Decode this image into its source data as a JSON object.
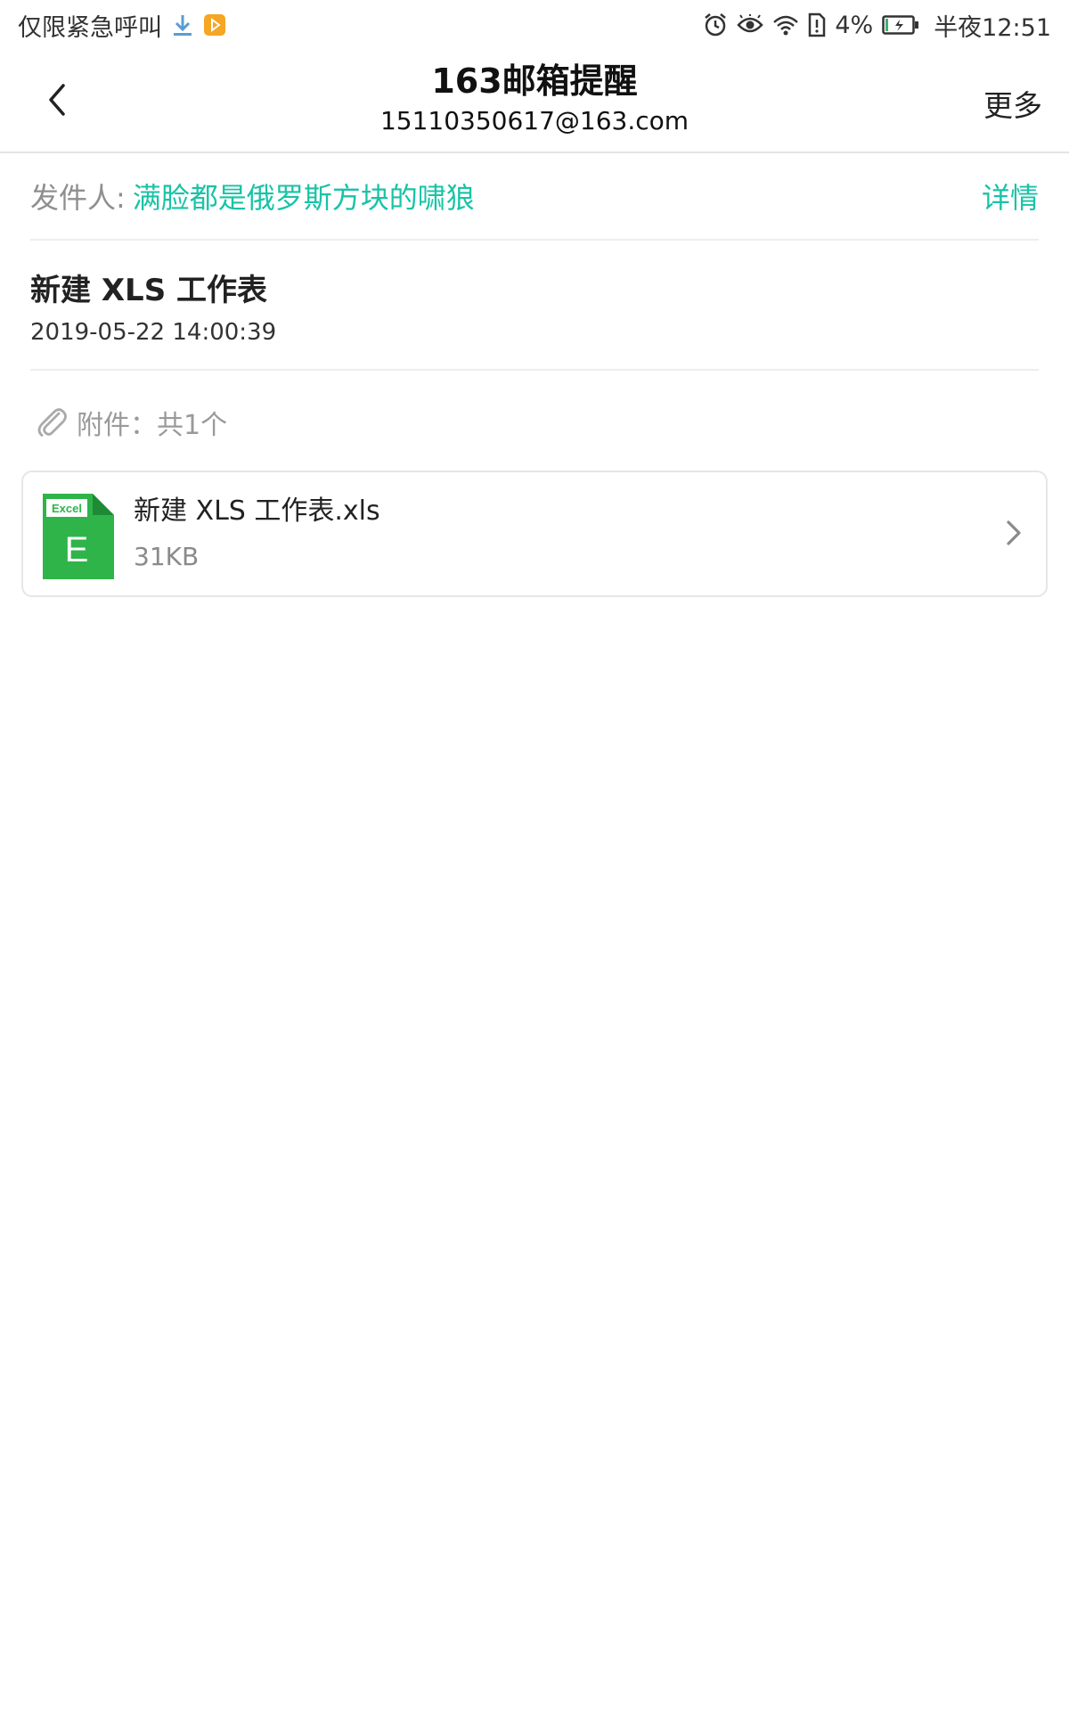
{
  "status_bar": {
    "carrier": "仅限紧急呼叫",
    "battery_percent": "4%",
    "time": "半夜12:51",
    "icons": [
      "download-icon",
      "play-store-icon",
      "alarm-icon",
      "eye-comfort-icon",
      "wifi-icon",
      "sim-alert-icon",
      "battery-charging-icon"
    ]
  },
  "header": {
    "title": "163邮箱提醒",
    "subtitle": "15110350617@163.com",
    "more_label": "更多"
  },
  "sender": {
    "label": "发件人:",
    "name": "满脸都是俄罗斯方块的啸狼",
    "detail_label": "详情"
  },
  "mail": {
    "subject": "新建 XLS 工作表",
    "date": "2019-05-22 14:00:39"
  },
  "attachments": {
    "header": "附件：共1个",
    "items": [
      {
        "icon_badge": "Excel",
        "icon_letter": "E",
        "name": "新建 XLS 工作表.xls",
        "size": "31KB"
      }
    ]
  },
  "colors": {
    "accent": "#19c3a6",
    "excel_green": "#2fb44a",
    "download_blue": "#5b9bd5",
    "badge_orange": "#f5a623"
  }
}
